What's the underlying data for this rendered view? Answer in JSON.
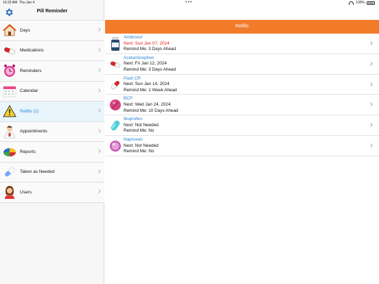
{
  "status_bar": {
    "time": "10:32 AM",
    "date": "Thu Jan 4",
    "dots": "•••",
    "battery": "100%"
  },
  "app": {
    "title": "Pill Reminder"
  },
  "sidebar": {
    "items": [
      {
        "label": "Days",
        "icon": "house-icon"
      },
      {
        "label": "Medications",
        "icon": "capsule-icon"
      },
      {
        "label": "Reminders",
        "icon": "alarm-clock-icon"
      },
      {
        "label": "Calendar",
        "icon": "calendar-icon"
      },
      {
        "label": "Refills (1)",
        "icon": "warning-icon"
      },
      {
        "label": "Appointments",
        "icon": "doctor-icon"
      },
      {
        "label": "Reports",
        "icon": "pie-chart-icon"
      },
      {
        "label": "Taken as Needed",
        "icon": "pill-icon"
      },
      {
        "label": "Users",
        "icon": "user-icon"
      }
    ],
    "active_index": 4
  },
  "main": {
    "title": "Refills",
    "refills": [
      {
        "name": "Ambroxol",
        "next": "Next: Sun Jan 07, 2024",
        "remind": "Remind Me: 3 Days Ahead",
        "overdue": true,
        "icon": "bottle-icon"
      },
      {
        "name": "Acetaminophen",
        "next": "Next: Fri Jan 12, 2024",
        "remind": "Remind Me: 3 Days Ahead",
        "overdue": false,
        "icon": "capsule-icon"
      },
      {
        "name": "Paxil CR",
        "next": "Next: Sun Jan 14, 2024",
        "remind": "Remind Me: 1 Week Ahead",
        "overdue": false,
        "icon": "capsule-icon"
      },
      {
        "name": "BCP",
        "next": "Next: Wed Jan 24, 2024",
        "remind": "Remind Me: 10 Days Ahead",
        "overdue": false,
        "icon": "tablet-icon"
      },
      {
        "name": "Ibuprofen",
        "next": "Next: Not Needed",
        "remind": "Remind Me: No",
        "overdue": false,
        "icon": "oval-pill-icon"
      },
      {
        "name": "Naproxen",
        "next": "Next: Not Needed",
        "remind": "Remind Me: No",
        "overdue": false,
        "icon": "round-pill-icon"
      }
    ]
  },
  "colors": {
    "accent": "#f27b2a",
    "link": "#2a82d6",
    "overdue": "#e02020",
    "active_row": "#e8f5fb"
  }
}
